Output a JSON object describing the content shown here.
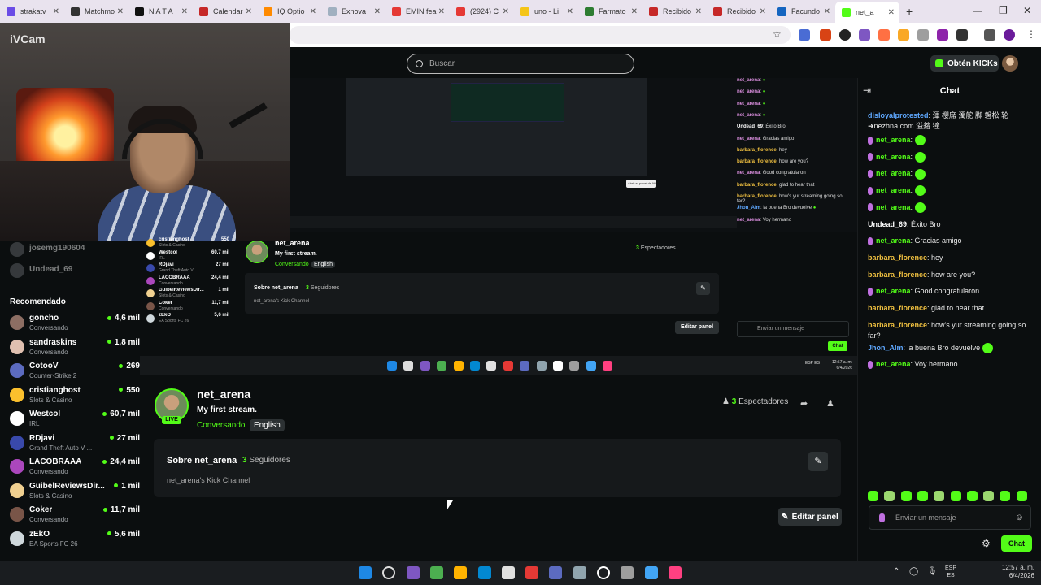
{
  "browser": {
    "tabs": [
      {
        "label": "strakatv",
        "color": "#6b4ce6"
      },
      {
        "label": "Matchmo",
        "color": "#333333"
      },
      {
        "label": "N A T A",
        "color": "#111111"
      },
      {
        "label": "Calendar",
        "color": "#c62828"
      },
      {
        "label": "IQ Optio",
        "color": "#ff8a00"
      },
      {
        "label": "Exnova",
        "color": "#a0b0c0"
      },
      {
        "label": "EMIN fea",
        "color": "#e53935"
      },
      {
        "label": "(2924) C",
        "color": "#e53935"
      },
      {
        "label": "uno - Li",
        "color": "#f5c518"
      },
      {
        "label": "Farmato",
        "color": "#2e7d32"
      },
      {
        "label": "Recibido",
        "color": "#c62828"
      },
      {
        "label": "Recibido",
        "color": "#c62828"
      },
      {
        "label": "Facundo",
        "color": "#1565c0"
      },
      {
        "label": "net_a",
        "color": "#53fc18"
      }
    ],
    "new_tab": "+"
  },
  "webcam": {
    "label": "iVCam"
  },
  "header": {
    "search_placeholder": "Buscar",
    "get_kicks": "Obtén KICKs"
  },
  "sidebar": {
    "partial": [
      {
        "name": "josemg190604",
        "viewers": ""
      },
      {
        "name": "Undead_69",
        "viewers": ""
      }
    ],
    "heading": "Recomendado",
    "recommended": [
      {
        "name": "goncho",
        "category": "Conversando",
        "viewers": "4,6 mil",
        "color": "#8d6e63"
      },
      {
        "name": "sandraskins",
        "category": "Conversando",
        "viewers": "1,8 mil",
        "color": "#e0c0b0"
      },
      {
        "name": "CotooV",
        "category": "Counter-Strike 2",
        "viewers": "269",
        "color": "#5c6bc0"
      },
      {
        "name": "cristianghost",
        "category": "Slots & Casino",
        "viewers": "550",
        "color": "#fbc02d"
      },
      {
        "name": "Westcol",
        "category": "IRL",
        "viewers": "60,7 mil",
        "color": "#ffffff"
      },
      {
        "name": "RDjavi",
        "category": "Grand Theft Auto V ...",
        "viewers": "27 mil",
        "color": "#3949ab"
      },
      {
        "name": "LACOBRAAA",
        "category": "Conversando",
        "viewers": "24,4 mil",
        "color": "#ab47bc"
      },
      {
        "name": "GuibelReviewsDir...",
        "category": "Slots & Casino",
        "viewers": "1 mil",
        "color": "#f0d090"
      },
      {
        "name": "Coker",
        "category": "Conversando",
        "viewers": "11,7 mil",
        "color": "#795548"
      },
      {
        "name": "zEkO",
        "category": "EA Sports FC 26",
        "viewers": "5,6 mil",
        "color": "#cfd8dc"
      }
    ]
  },
  "preview": {
    "chat": [
      {
        "user": "net_arena",
        "text": ""
      },
      {
        "user": "net_arena",
        "text": ""
      },
      {
        "user": "net_arena",
        "text": ""
      },
      {
        "user": "net_arena",
        "text": ""
      },
      {
        "user": "Undead_69",
        "text": "Éxito Bro"
      },
      {
        "user": "net_arena",
        "text": "Gracias amigo"
      },
      {
        "user": "barbara_florence",
        "text": "hey"
      },
      {
        "user": "barbara_florence",
        "text": "how are you?"
      },
      {
        "user": "net_arena",
        "text": "Good congratularon"
      },
      {
        "user": "barbara_florence",
        "text": "glad to hear that"
      },
      {
        "user": "barbara_florence",
        "text": "how's yur streaming going so far?"
      },
      {
        "user": "Jhon_Alm",
        "text": "la buena Bro devuelve"
      },
      {
        "user": "net_arena",
        "text": "Voy hermano"
      }
    ],
    "tooltip": "Abrir el panel de Moderación",
    "mini_channel": {
      "name": "net_arena",
      "title": "My first stream.",
      "category": "Conversando",
      "language": "English",
      "viewers_count": "3",
      "viewers_label": "Espectadores",
      "about_title": "Sobre net_arena",
      "followers_count": "3",
      "followers_label": "Seguidores",
      "description": "net_arena's Kick Channel",
      "edit_panel": "Editar panel",
      "chat_placeholder": "Enviar un mensaje",
      "chat_button": "Chat",
      "clock": "12:57 a. m.",
      "date": "6/4/2026",
      "lang": "ESP ES"
    }
  },
  "channel": {
    "name": "net_arena",
    "live": "LIVE",
    "title": "My first stream.",
    "category": "Conversando",
    "language": "English",
    "viewers_count": "3",
    "viewers_label": "Espectadores",
    "about_title": "Sobre net_arena",
    "followers_count": "3",
    "followers_label": "Seguidores",
    "description": "net_arena's Kick Channel",
    "edit_panel": "Editar panel"
  },
  "chat": {
    "title": "Chat",
    "messages": [
      {
        "user": "disloyalprotested",
        "color": "#5fa8ff",
        "text": ": 渾 櫻席 濁舵 脚 磐松 轮 ➜nezhna.com 溢鎔 犝",
        "badge": false,
        "emote": false
      },
      {
        "user": "net_arena",
        "color": "#53fc18",
        "text": ":",
        "badge": true,
        "emote": true
      },
      {
        "user": "net_arena",
        "color": "#53fc18",
        "text": ":",
        "badge": true,
        "emote": true
      },
      {
        "user": "net_arena",
        "color": "#53fc18",
        "text": ":",
        "badge": true,
        "emote": true
      },
      {
        "user": "net_arena",
        "color": "#53fc18",
        "text": ":",
        "badge": true,
        "emote": true
      },
      {
        "user": "net_arena",
        "color": "#53fc18",
        "text": ":",
        "badge": true,
        "emote": true
      },
      {
        "user": "Undead_69",
        "color": "#ffffff",
        "text": ": Éxito Bro",
        "badge": false,
        "emote": false
      },
      {
        "user": "net_arena",
        "color": "#53fc18",
        "text": ": Gracias amigo",
        "badge": true,
        "emote": false
      },
      {
        "user": "barbara_florence",
        "color": "#f0c040",
        "text": ": hey",
        "badge": false,
        "emote": false
      },
      {
        "user": "barbara_florence",
        "color": "#f0c040",
        "text": ": how are you?",
        "badge": false,
        "emote": false
      },
      {
        "user": "net_arena",
        "color": "#53fc18",
        "text": ": Good congratularon",
        "badge": true,
        "emote": false
      },
      {
        "user": "barbara_florence",
        "color": "#f0c040",
        "text": ": glad to hear that",
        "badge": false,
        "emote": false
      },
      {
        "user": "barbara_florence",
        "color": "#f0c040",
        "text": ": how's yur streaming going so far?",
        "badge": false,
        "emote": false
      },
      {
        "user": "Jhon_Alm",
        "color": "#5fa8ff",
        "text": ": la buena Bro devuelve",
        "badge": false,
        "emote": true
      },
      {
        "user": "net_arena",
        "color": "#53fc18",
        "text": ": Voy hermano",
        "badge": true,
        "emote": false
      }
    ],
    "input_placeholder": "Enviar un mensaje",
    "send_label": "Chat"
  },
  "taskbar": {
    "lang_top": "ESP",
    "lang_bottom": "ES",
    "time": "12:57 a. m.",
    "date": "6/4/2026"
  },
  "colors": {
    "accent": "#53fc18",
    "background": "#0b0e0f",
    "panel": "#16191b"
  }
}
